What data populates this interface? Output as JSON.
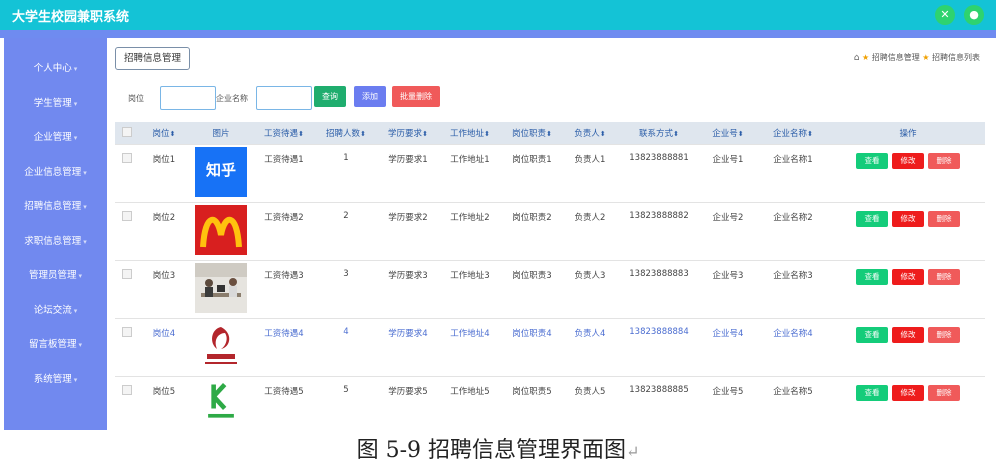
{
  "app": {
    "title": "大学生校园兼职系统"
  },
  "sidebar": {
    "items": [
      {
        "label": "个人中心"
      },
      {
        "label": "学生管理"
      },
      {
        "label": "企业管理"
      },
      {
        "label": "企业信息管理"
      },
      {
        "label": "招聘信息管理"
      },
      {
        "label": "求职信息管理"
      },
      {
        "label": "管理员管理"
      },
      {
        "label": "论坛交流"
      },
      {
        "label": "留言板管理"
      },
      {
        "label": "系统管理"
      }
    ]
  },
  "tab": {
    "label": "招聘信息管理"
  },
  "breadcrumb": {
    "first": "招聘信息管理",
    "second": "招聘信息列表"
  },
  "search": {
    "label_post": "岗位",
    "label_company": "企业名称",
    "query": "查询",
    "add": "添加",
    "batch_delete": "批量删除"
  },
  "table": {
    "headers": [
      "岗位",
      "图片",
      "工资待遇",
      "招聘人数",
      "学历要求",
      "工作地址",
      "岗位职责",
      "负责人",
      "联系方式",
      "企业号",
      "企业名称",
      "操作"
    ],
    "rows": [
      {
        "post": "岗位1",
        "salary": "工资待遇1",
        "count": "1",
        "edu": "学历要求1",
        "addr": "工作地址1",
        "duty": "岗位职责1",
        "owner": "负责人1",
        "phone": "13823888881",
        "cid": "企业号1",
        "cname": "企业名称1",
        "image": "zhihu-logo",
        "logo_text": "知乎"
      },
      {
        "post": "岗位2",
        "salary": "工资待遇2",
        "count": "2",
        "edu": "学历要求2",
        "addr": "工作地址2",
        "duty": "岗位职责2",
        "owner": "负责人2",
        "phone": "13823888882",
        "cid": "企业号2",
        "cname": "企业名称2",
        "image": "mcdonalds-logo",
        "logo_text": ""
      },
      {
        "post": "岗位3",
        "salary": "工资待遇3",
        "count": "3",
        "edu": "学历要求3",
        "addr": "工作地址3",
        "duty": "岗位职责3",
        "owner": "负责人3",
        "phone": "13823888883",
        "cid": "企业号3",
        "cname": "企业名称3",
        "image": "office-photo",
        "logo_text": ""
      },
      {
        "post": "岗位4",
        "salary": "工资待遇4",
        "count": "4",
        "edu": "学历要求4",
        "addr": "工作地址4",
        "duty": "岗位职责4",
        "owner": "负责人4",
        "phone": "13823888884",
        "cid": "企业号4",
        "cname": "企业名称4",
        "image": "decor-logo",
        "logo_text": ""
      },
      {
        "post": "岗位5",
        "salary": "工资待遇5",
        "count": "5",
        "edu": "学历要求5",
        "addr": "工作地址5",
        "duty": "岗位职责5",
        "owner": "负责人5",
        "phone": "13823888885",
        "cid": "企业号5",
        "cname": "企业名称5",
        "image": "medical-logo",
        "logo_text": ""
      }
    ],
    "actions": {
      "view": "查看",
      "edit": "修改",
      "delete": "删除"
    }
  },
  "caption": "图 5-9 招聘信息管理界面图",
  "colors": {
    "topbar": "#14c3d6",
    "sidebar": "#7189ef",
    "query": "#1fad6e",
    "add": "#6b7df0",
    "delete": "#f05a5a",
    "edit": "#ee1c1c",
    "view": "#14cc7a"
  }
}
